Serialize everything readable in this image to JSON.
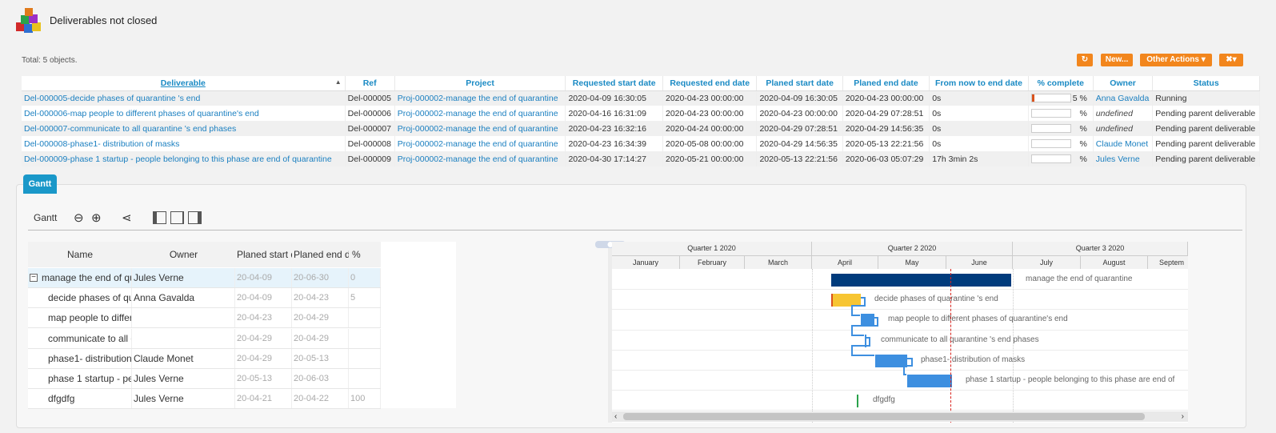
{
  "header": {
    "title": "Deliverables not closed",
    "total": "Total: 5 objects."
  },
  "toolbar": {
    "refresh_icon": "refresh-icon",
    "new_label": "New...",
    "other_label": "Other Actions",
    "tools_icon": "tools-icon"
  },
  "table": {
    "columns": [
      "Deliverable",
      "Ref",
      "Project",
      "Requested start date",
      "Requested end date",
      "Planed start date",
      "Planed end date",
      "From now to end date",
      "% complete",
      "Owner",
      "Status"
    ],
    "rows": [
      {
        "deliverable": "Del-000005-decide phases of quarantine 's end",
        "ref": "Del-000005",
        "project": "Proj-000002-manage the end of quarantine",
        "req_start": "2020-04-09 16:30:05",
        "req_end": "2020-04-23 00:00:00",
        "plan_start": "2020-04-09 16:30:05",
        "plan_end": "2020-04-23 00:00:00",
        "from_now": "0s",
        "pct": "5 %",
        "pct_value": 0.05,
        "owner": "Anna Gavalda",
        "status": "Running"
      },
      {
        "deliverable": "Del-000006-map people to different phases of quarantine's end",
        "ref": "Del-000006",
        "project": "Proj-000002-manage the end of quarantine",
        "req_start": "2020-04-16 16:31:09",
        "req_end": "2020-04-23 00:00:00",
        "plan_start": "2020-04-23 00:00:00",
        "plan_end": "2020-04-29 07:28:51",
        "from_now": "0s",
        "pct": "%",
        "pct_value": 0,
        "owner": "undefined",
        "status": "Pending parent deliverable"
      },
      {
        "deliverable": "Del-000007-communicate to all quarantine 's end phases",
        "ref": "Del-000007",
        "project": "Proj-000002-manage the end of quarantine",
        "req_start": "2020-04-23 16:32:16",
        "req_end": "2020-04-24 00:00:00",
        "plan_start": "2020-04-29 07:28:51",
        "plan_end": "2020-04-29 14:56:35",
        "from_now": "0s",
        "pct": "%",
        "pct_value": 0,
        "owner": "undefined",
        "status": "Pending parent deliverable"
      },
      {
        "deliverable": "Del-000008-phase1- distribution of masks",
        "ref": "Del-000008",
        "project": "Proj-000002-manage the end of quarantine",
        "req_start": "2020-04-23 16:34:39",
        "req_end": "2020-05-08 00:00:00",
        "plan_start": "2020-04-29 14:56:35",
        "plan_end": "2020-05-13 22:21:56",
        "from_now": "0s",
        "pct": "%",
        "pct_value": 0,
        "owner": "Claude Monet",
        "status": "Pending parent deliverable"
      },
      {
        "deliverable": "Del-000009-phase 1 startup - people belonging to this phase are end of quarantine",
        "ref": "Del-000009",
        "project": "Proj-000002-manage the end of quarantine",
        "req_start": "2020-04-30 17:14:27",
        "req_end": "2020-05-21 00:00:00",
        "plan_start": "2020-05-13 22:21:56",
        "plan_end": "2020-06-03 05:07:29",
        "from_now": "17h 3min 2s",
        "pct": "%",
        "pct_value": 0,
        "owner": "Jules Verne",
        "status": "Pending parent deliverable"
      }
    ]
  },
  "gantt": {
    "tab": "Gantt",
    "toolbar_label": "Gantt",
    "columns": [
      "Name",
      "Owner",
      "Planed start d",
      "Planed end da",
      "%"
    ],
    "rows": [
      {
        "name": "manage the end of qu",
        "owner": "Jules Verne",
        "start": "20-04-09",
        "end": "20-06-30",
        "pct": "0"
      },
      {
        "name": "decide phases of qu",
        "owner": "Anna Gavalda",
        "start": "20-04-09",
        "end": "20-04-23",
        "pct": "5"
      },
      {
        "name": "map people to differ",
        "owner": "",
        "start": "20-04-23",
        "end": "20-04-29",
        "pct": ""
      },
      {
        "name": "communicate to all q",
        "owner": "",
        "start": "20-04-29",
        "end": "20-04-29",
        "pct": ""
      },
      {
        "name": "phase1- distribution",
        "owner": "Claude Monet",
        "start": "20-04-29",
        "end": "20-05-13",
        "pct": ""
      },
      {
        "name": "phase 1 startup - pe",
        "owner": "Jules Verne",
        "start": "20-05-13",
        "end": "20-06-03",
        "pct": ""
      },
      {
        "name": "dfgdfg",
        "owner": "Jules Verne",
        "start": "20-04-21",
        "end": "20-04-22",
        "pct": "100"
      }
    ],
    "quarters": [
      "Quarter 1 2020",
      "Quarter 2 2020",
      "Quarter 3 2020"
    ],
    "months": [
      "January",
      "February",
      "March",
      "April",
      "May",
      "June",
      "July",
      "August",
      "Septem"
    ],
    "bar_labels": [
      "manage the end of quarantine",
      "decide phases of quarantine 's end",
      "map people to different phases of quarantine's end",
      "communicate to all quarantine 's end phases",
      "phase1- distribution of masks",
      "phase 1 startup - people belonging to this phase are end of",
      "dfgdfg"
    ],
    "colors": {
      "project": "#003b7c",
      "task": "#3d8fe0",
      "running": "#f7c532",
      "today": "#d9231d",
      "accent": "#1a98c9",
      "action": "#f2861d"
    }
  }
}
